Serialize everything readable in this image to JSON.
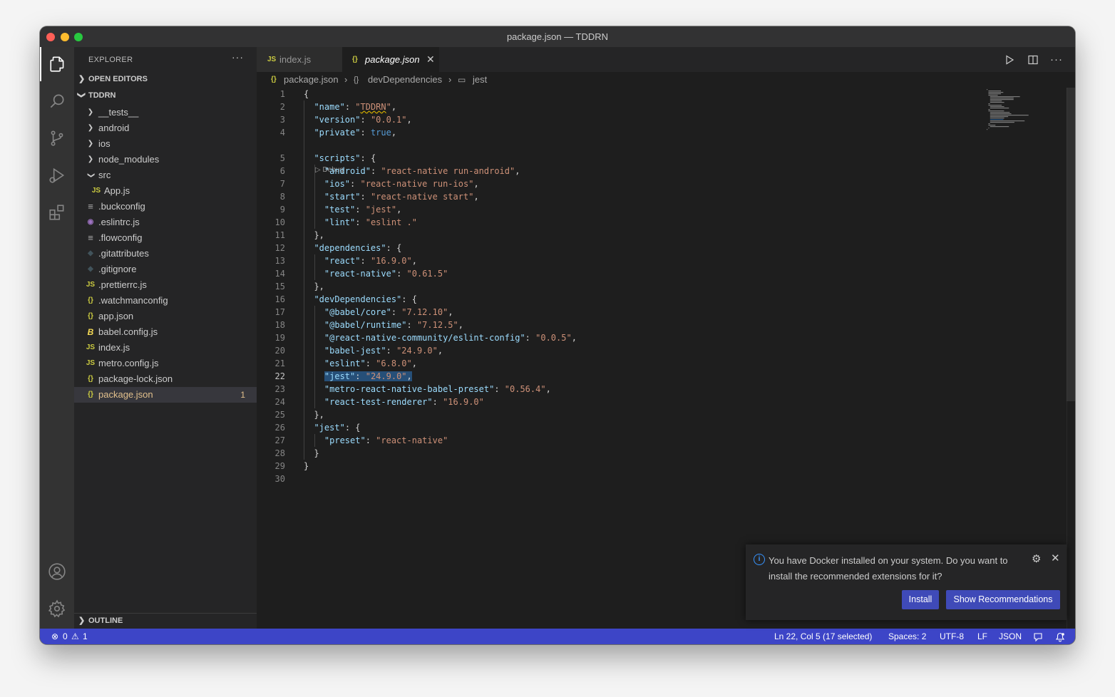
{
  "window": {
    "title": "package.json — TDDRN"
  },
  "activity_bar": {
    "icons": [
      "explorer-icon",
      "search-icon",
      "source-control-icon",
      "run-debug-icon",
      "extensions-icon",
      "account-icon",
      "manage-gear-icon"
    ]
  },
  "sidebar": {
    "header": "EXPLORER",
    "more": "···",
    "open_editors": "OPEN EDITORS",
    "project": "TDDRN",
    "outline": "OUTLINE",
    "tree": [
      {
        "name": "__tests__",
        "type": "folder",
        "icon": "chevron-right",
        "depth": 1
      },
      {
        "name": "android",
        "type": "folder",
        "icon": "chevron-right",
        "depth": 1
      },
      {
        "name": "ios",
        "type": "folder",
        "icon": "chevron-right",
        "depth": 1
      },
      {
        "name": "node_modules",
        "type": "folder",
        "icon": "chevron-right",
        "depth": 1
      },
      {
        "name": "src",
        "type": "folder",
        "icon": "chevron-down",
        "depth": 1
      },
      {
        "name": "App.js",
        "type": "js",
        "icon": "JS",
        "depth": 2
      },
      {
        "name": ".buckconfig",
        "type": "config",
        "icon": "≡",
        "depth": 1
      },
      {
        "name": ".eslintrc.js",
        "type": "eslint",
        "icon": "◉",
        "depth": 1
      },
      {
        "name": ".flowconfig",
        "type": "config",
        "icon": "≡",
        "depth": 1
      },
      {
        "name": ".gitattributes",
        "type": "git",
        "icon": "◆",
        "depth": 1
      },
      {
        "name": ".gitignore",
        "type": "git",
        "icon": "◆",
        "depth": 1
      },
      {
        "name": ".prettierrc.js",
        "type": "js",
        "icon": "JS",
        "depth": 1
      },
      {
        "name": ".watchmanconfig",
        "type": "json",
        "icon": "{}",
        "depth": 1
      },
      {
        "name": "app.json",
        "type": "json",
        "icon": "{}",
        "depth": 1
      },
      {
        "name": "babel.config.js",
        "type": "babel",
        "icon": "B",
        "depth": 1
      },
      {
        "name": "index.js",
        "type": "js",
        "icon": "JS",
        "depth": 1
      },
      {
        "name": "metro.config.js",
        "type": "js",
        "icon": "JS",
        "depth": 1
      },
      {
        "name": "package-lock.json",
        "type": "json",
        "icon": "{}",
        "depth": 1
      },
      {
        "name": "package.json",
        "type": "json",
        "icon": "{}",
        "depth": 1,
        "selected": true,
        "badge": "1"
      }
    ]
  },
  "tabs": [
    {
      "label": "index.js",
      "icon": "JS",
      "active": false
    },
    {
      "label": "package.json",
      "icon": "{}",
      "active": true,
      "close": "✕"
    }
  ],
  "breadcrumb": [
    {
      "icon": "{}",
      "label": "package.json"
    },
    {
      "icon": "{}",
      "label": "devDependencies"
    },
    {
      "icon": "▭",
      "label": "jest"
    }
  ],
  "editor": {
    "current_line": 22,
    "codelens": "▷ Debug",
    "lines": [
      "{",
      "  \"name\": \"TDDRN\",",
      "  \"version\": \"0.0.1\",",
      "  \"private\": true,",
      "  \"scripts\": {",
      "    \"android\": \"react-native run-android\",",
      "    \"ios\": \"react-native run-ios\",",
      "    \"start\": \"react-native start\",",
      "    \"test\": \"jest\",",
      "    \"lint\": \"eslint .\"",
      "  },",
      "  \"dependencies\": {",
      "    \"react\": \"16.9.0\",",
      "    \"react-native\": \"0.61.5\"",
      "  },",
      "  \"devDependencies\": {",
      "    \"@babel/core\": \"7.12.10\",",
      "    \"@babel/runtime\": \"7.12.5\",",
      "    \"@react-native-community/eslint-config\": \"0.0.5\",",
      "    \"babel-jest\": \"24.9.0\",",
      "    \"eslint\": \"6.8.0\",",
      "    \"jest\": \"24.9.0\",",
      "    \"metro-react-native-babel-preset\": \"0.56.4\",",
      "    \"react-test-renderer\": \"16.9.0\"",
      "  },",
      "  \"jest\": {",
      "    \"preset\": \"react-native\"",
      "  }",
      "}",
      ""
    ]
  },
  "notification": {
    "message": "You have Docker installed on your system. Do you want to install the recommended extensions for it?",
    "install": "Install",
    "show_recommendations": "Show Recommendations"
  },
  "status_bar": {
    "errors": "0",
    "warnings": "1",
    "position": "Ln 22, Col 5 (17 selected)",
    "spaces": "Spaces: 2",
    "encoding": "UTF-8",
    "eol": "LF",
    "language": "JSON",
    "accent": "#3d45c7"
  }
}
